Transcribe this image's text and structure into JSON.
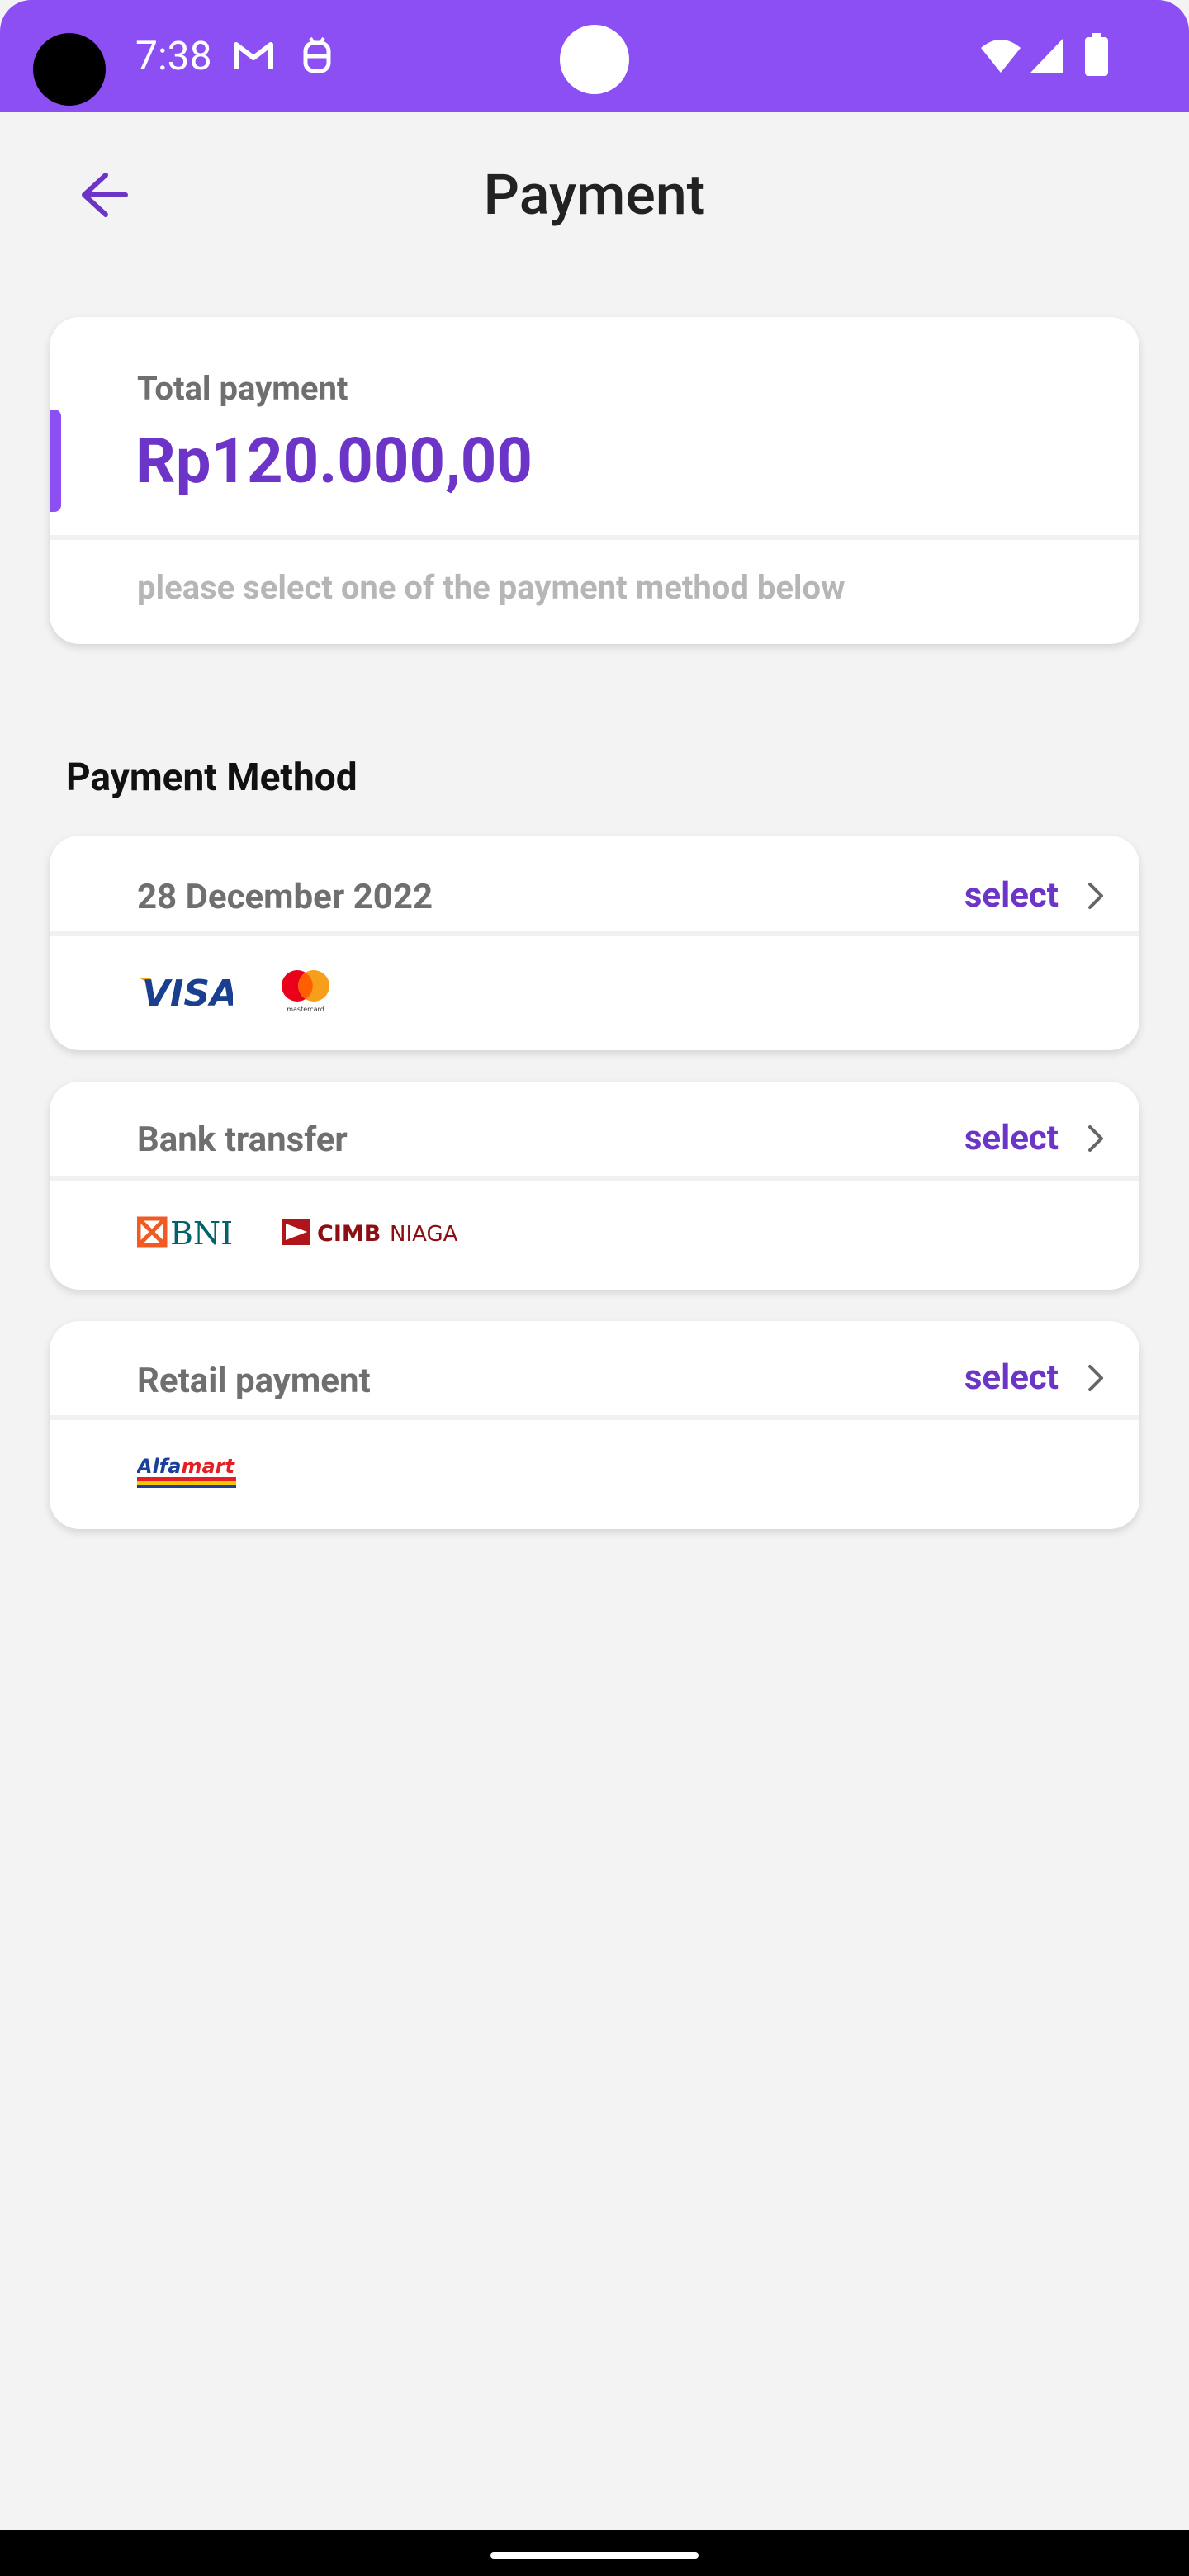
{
  "status_bar": {
    "time": "7:38",
    "icons": [
      "gmail-icon",
      "android-debug-icon",
      "wifi-icon",
      "signal-icon",
      "battery-icon"
    ]
  },
  "app_bar": {
    "title": "Payment",
    "back_icon": "arrow-left-icon"
  },
  "total": {
    "label": "Total payment",
    "amount": "Rp120.000,00",
    "note": "please select one of the payment method below"
  },
  "methods_section": {
    "title": "Payment Method",
    "items": [
      {
        "title": "28 December 2022",
        "select_label": "select",
        "logos": [
          "visa-logo",
          "mastercard-logo"
        ],
        "mastercard_caption": "mastercard"
      },
      {
        "title": "Bank transfer",
        "select_label": "select",
        "logos": [
          "bni-logo",
          "cimb-niaga-logo"
        ],
        "bni_text": "BNI",
        "cimb_text_bold": "CIMB",
        "cimb_text_light": "NIAGA"
      },
      {
        "title": "Retail payment",
        "select_label": "select",
        "logos": [
          "alfamart-logo"
        ]
      }
    ]
  },
  "colors": {
    "accent": "#8c4ff3",
    "accent_text": "#6c35c7",
    "background": "#f3f3f3"
  }
}
